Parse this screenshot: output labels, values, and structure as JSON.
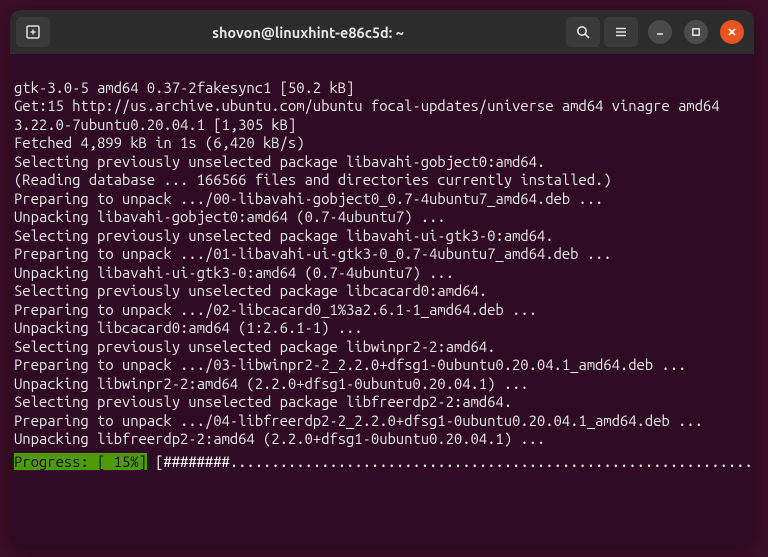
{
  "titlebar": {
    "title": "shovon@linuxhint-e86c5d: ~"
  },
  "terminal": {
    "lines": [
      "gtk-3.0-5 amd64 0.37-2fakesync1 [50.2 kB]",
      "Get:15 http://us.archive.ubuntu.com/ubuntu focal-updates/universe amd64 vinagre amd64 3.22.0-7ubuntu0.20.04.1 [1,305 kB]",
      "Fetched 4,899 kB in 1s (6,420 kB/s)",
      "Selecting previously unselected package libavahi-gobject0:amd64.",
      "(Reading database ... 166566 files and directories currently installed.)",
      "Preparing to unpack .../00-libavahi-gobject0_0.7-4ubuntu7_amd64.deb ...",
      "Unpacking libavahi-gobject0:amd64 (0.7-4ubuntu7) ...",
      "Selecting previously unselected package libavahi-ui-gtk3-0:amd64.",
      "Preparing to unpack .../01-libavahi-ui-gtk3-0_0.7-4ubuntu7_amd64.deb ...",
      "Unpacking libavahi-ui-gtk3-0:amd64 (0.7-4ubuntu7) ...",
      "Selecting previously unselected package libcacard0:amd64.",
      "Preparing to unpack .../02-libcacard0_1%3a2.6.1-1_amd64.deb ...",
      "Unpacking libcacard0:amd64 (1:2.6.1-1) ...",
      "Selecting previously unselected package libwinpr2-2:amd64.",
      "Preparing to unpack .../03-libwinpr2-2_2.2.0+dfsg1-0ubuntu0.20.04.1_amd64.deb ...",
      "Unpacking libwinpr2-2:amd64 (2.2.0+dfsg1-0ubuntu0.20.04.1) ...",
      "Selecting previously unselected package libfreerdp2-2:amd64.",
      "Preparing to unpack .../04-libfreerdp2-2_2.2.0+dfsg1-0ubuntu0.20.04.1_amd64.deb ...",
      "Unpacking libfreerdp2-2:amd64 (2.2.0+dfsg1-0ubuntu0.20.04.1) ..."
    ],
    "progress_label": "Progress: [ 15%]",
    "progress_bar": " [########.................................................................] ",
    "progress_percent": 15
  }
}
